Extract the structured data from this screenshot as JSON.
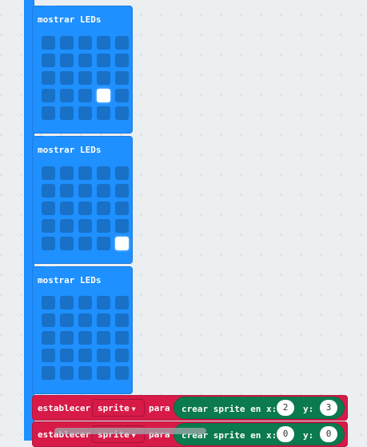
{
  "colors": {
    "workspace": "#eceff1",
    "basic_block": "#1e90ff",
    "led_off": "#1870c7",
    "led_on": "#ffffff",
    "variables_block": "#d71a47",
    "game_pill": "#0b7a4e"
  },
  "blocks": [
    {
      "label": "mostrar LEDs",
      "leds": [
        [
          0,
          0,
          0,
          0,
          0
        ],
        [
          0,
          0,
          0,
          0,
          0
        ],
        [
          0,
          0,
          0,
          0,
          0
        ],
        [
          0,
          0,
          0,
          1,
          0
        ],
        [
          0,
          0,
          0,
          0,
          0
        ]
      ]
    },
    {
      "label": "mostrar LEDs",
      "leds": [
        [
          0,
          0,
          0,
          0,
          0
        ],
        [
          0,
          0,
          0,
          0,
          0
        ],
        [
          0,
          0,
          0,
          0,
          0
        ],
        [
          0,
          0,
          0,
          0,
          0
        ],
        [
          0,
          0,
          0,
          0,
          1
        ]
      ]
    },
    {
      "label": "mostrar LEDs",
      "leds": [
        [
          0,
          0,
          0,
          0,
          0
        ],
        [
          0,
          0,
          0,
          0,
          0
        ],
        [
          0,
          0,
          0,
          0,
          0
        ],
        [
          0,
          0,
          0,
          0,
          0
        ],
        [
          0,
          0,
          0,
          0,
          0
        ]
      ]
    }
  ],
  "set_blocks": [
    {
      "set_label": "establecer",
      "variable": "sprite",
      "to_label": "para",
      "create_label": "crear sprite en x:",
      "x_value": "2",
      "y_label": "y:",
      "y_value": "3"
    },
    {
      "set_label": "establecer",
      "variable": "sprite",
      "to_label": "para",
      "create_label": "crear sprite en x:",
      "x_value": "0",
      "y_label": "y:",
      "y_value": "0"
    }
  ]
}
